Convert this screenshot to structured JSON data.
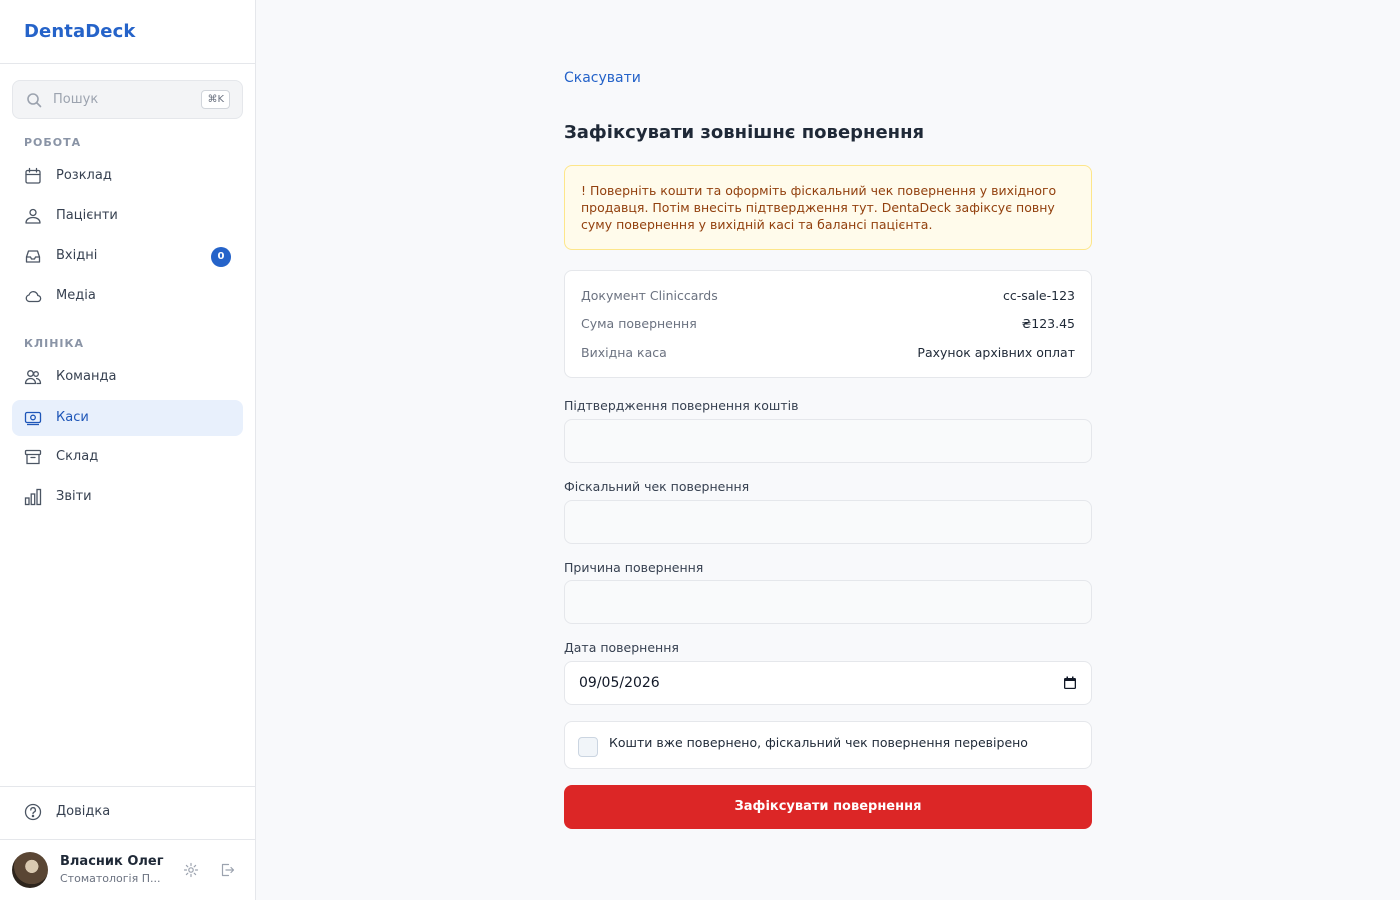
{
  "brand": "DentaDeck",
  "search": {
    "placeholder": "Пошук",
    "shortcut": "⌘K"
  },
  "sidebar": {
    "sections": [
      {
        "label": "РОБОТА",
        "items": [
          {
            "label": "Розклад",
            "icon": "calendar-icon"
          },
          {
            "label": "Пацієнти",
            "icon": "patients-icon"
          },
          {
            "label": "Вхідні",
            "icon": "inbox-icon",
            "badge": "0"
          },
          {
            "label": "Медіа",
            "icon": "cloud-icon"
          }
        ]
      },
      {
        "label": "КЛІНІКА",
        "items": [
          {
            "label": "Команда",
            "icon": "team-icon"
          },
          {
            "label": "Каси",
            "icon": "cash-icon",
            "active": true
          },
          {
            "label": "Склад",
            "icon": "archive-icon"
          },
          {
            "label": "Звіти",
            "icon": "bar-chart-icon"
          }
        ]
      }
    ],
    "help": {
      "label": "Довідка",
      "icon": "help-icon"
    },
    "user": {
      "name": "Власник Олег",
      "org": "Стоматологія П..."
    }
  },
  "main": {
    "cancel_label": "Скасувати",
    "title": "Зафіксувати зовнішнє повернення",
    "warning": "! Поверніть кошти та оформіть фіскальний чек повернення у вихідного продавця. Потім внесіть підтвердження тут. DentaDeck зафіксує повну суму повернення у вихідній касі та балансі пацієнта.",
    "details": [
      {
        "label": "Документ Cliniccards",
        "value": "cc-sale-123"
      },
      {
        "label": "Сума повернення",
        "value": "₴123.45"
      },
      {
        "label": "Вихідна каса",
        "value": "Рахунок архівних оплат"
      }
    ],
    "fields": {
      "refund_confirmation": {
        "label": "Підтвердження повернення коштів",
        "value": ""
      },
      "fiscal_receipt": {
        "label": "Фіскальний чек повернення",
        "value": ""
      },
      "refund_reason": {
        "label": "Причина повернення",
        "value": ""
      },
      "refund_date": {
        "label": "Дата повернення",
        "value": "09/05/2026"
      }
    },
    "confirm_label": "Кошти вже повернено, фіскальний чек повернення перевірено",
    "confirm_checked": false,
    "submit_label": "Зафіксувати повернення"
  },
  "colors": {
    "accent": "#2563c9",
    "danger": "#dc2626",
    "warning_bg": "#fffbeb",
    "warning_text": "#92400e"
  }
}
